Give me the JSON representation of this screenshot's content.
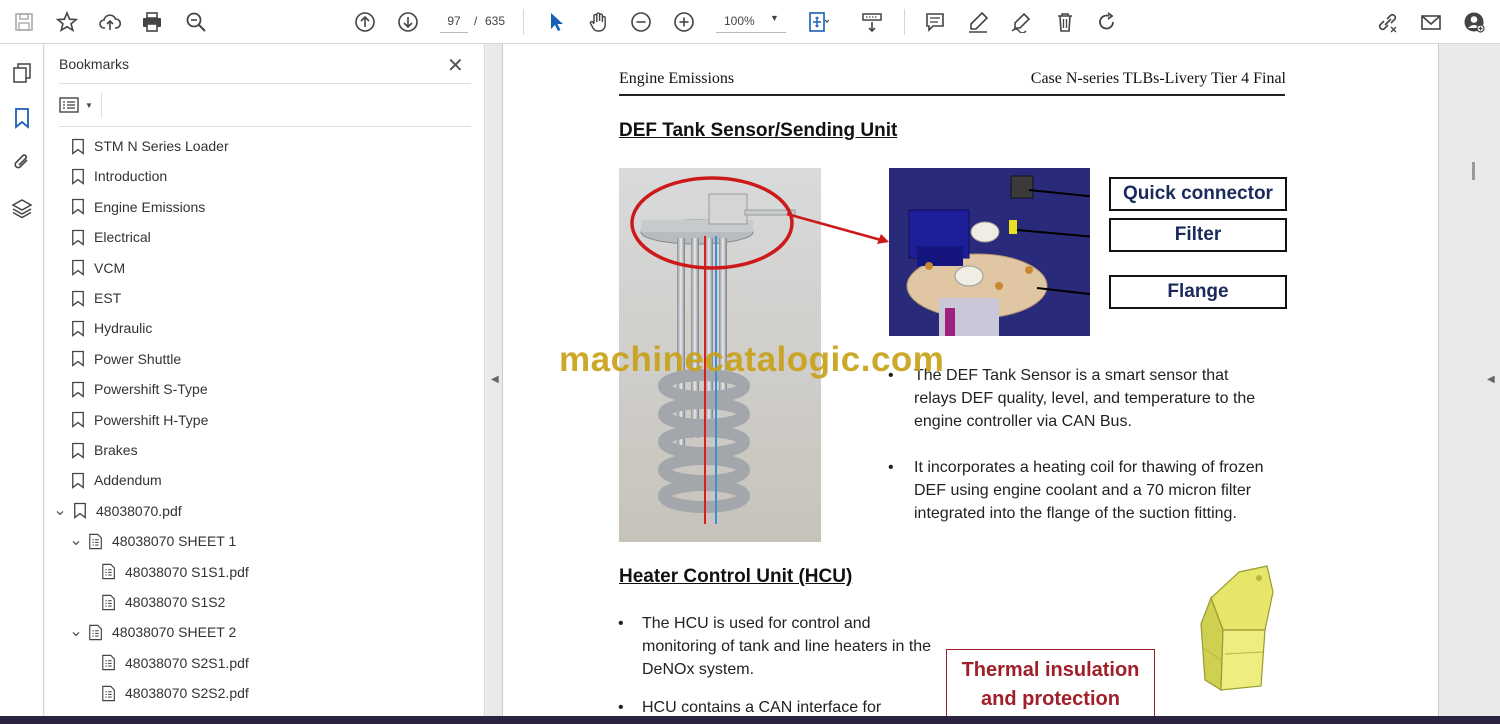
{
  "toolbar": {
    "page_current": "97",
    "page_separator": "/",
    "page_total": "635",
    "zoom": "100%"
  },
  "bookmarks": {
    "title": "Bookmarks",
    "items": [
      {
        "label": "STM N Series Loader"
      },
      {
        "label": "Introduction"
      },
      {
        "label": "Engine Emissions"
      },
      {
        "label": "Electrical"
      },
      {
        "label": "VCM"
      },
      {
        "label": "EST"
      },
      {
        "label": "Hydraulic"
      },
      {
        "label": "Power Shuttle"
      },
      {
        "label": "Powershift S-Type"
      },
      {
        "label": "Powershift H-Type"
      },
      {
        "label": "Brakes"
      },
      {
        "label": "Addendum"
      },
      {
        "label": "48038070.pdf"
      },
      {
        "label": "48038070 SHEET 1"
      },
      {
        "label": "48038070 S1S1.pdf"
      },
      {
        "label": "48038070 S1S2"
      },
      {
        "label": "48038070 SHEET 2"
      },
      {
        "label": "48038070 S2S1.pdf"
      },
      {
        "label": "48038070 S2S2.pdf"
      }
    ]
  },
  "page": {
    "header_left": "Engine Emissions",
    "header_right": "Case N-series TLBs-Livery Tier 4 Final",
    "section1_title": "DEF Tank Sensor/Sending Unit",
    "callouts": {
      "quick_connector": "Quick connector",
      "filter": "Filter",
      "flange": "Flange"
    },
    "bullets1": [
      "The DEF Tank Sensor is a smart sensor that relays DEF quality, level, and temperature to the engine controller via CAN Bus.",
      "It incorporates a heating coil for thawing of frozen DEF using engine coolant and a 70 micron filter integrated into the flange of the suction fitting."
    ],
    "section2_title": "Heater Control Unit (HCU)",
    "bullets2": [
      "The HCU is used for control and monitoring of tank and line heaters in the DeNOx system.",
      "HCU contains a CAN interface for"
    ],
    "thermal_line1": "Thermal insulation",
    "thermal_line2": "and protection",
    "watermark": "machinecatalogic.com"
  }
}
